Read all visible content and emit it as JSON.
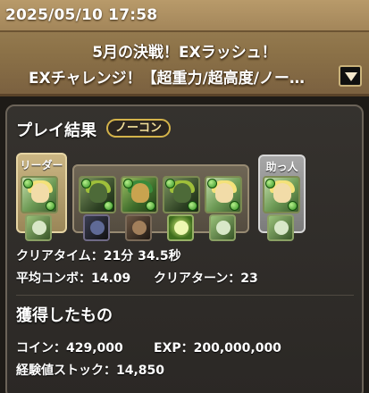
{
  "header": {
    "datetime": "2025/05/10 17:58",
    "dungeon_name": "5月の決戦！EXラッシュ！",
    "floor_name": "EXチャレンジ！【超重力/超高度/ノー…",
    "dropdown_icon": "triangle-down-icon"
  },
  "result": {
    "title": "プレイ結果",
    "badge": "ノーコン",
    "team": {
      "leader_label": "リーダー",
      "helper_label": "助っ人",
      "members": [
        {
          "role": "leader",
          "style": "light",
          "assist": "light"
        },
        {
          "role": "sub",
          "style": "dark",
          "assist": "black"
        },
        {
          "role": "sub",
          "style": "mech",
          "assist": "brown"
        },
        {
          "role": "sub",
          "style": "dark",
          "assist": "orb"
        },
        {
          "role": "sub",
          "style": "light",
          "assist": "light"
        },
        {
          "role": "helper",
          "style": "light",
          "assist": "light"
        }
      ]
    },
    "clear_time": "クリアタイム：21分 34.5秒",
    "avg_combo": "平均コンボ：14.09",
    "clear_turns": "クリアターン：23"
  },
  "rewards": {
    "title": "獲得したもの",
    "coin": "コイン：429,000",
    "exp": "EXP：200,000,000",
    "exp_stock": "経験値ストック：14,850"
  },
  "colors": {
    "header_brown": "#8c7248",
    "panel_bg": "#2f2c28",
    "badge_gold": "#d4b34a",
    "leader_gold": "#cbb683",
    "helper_silver": "#a7a7a7"
  }
}
